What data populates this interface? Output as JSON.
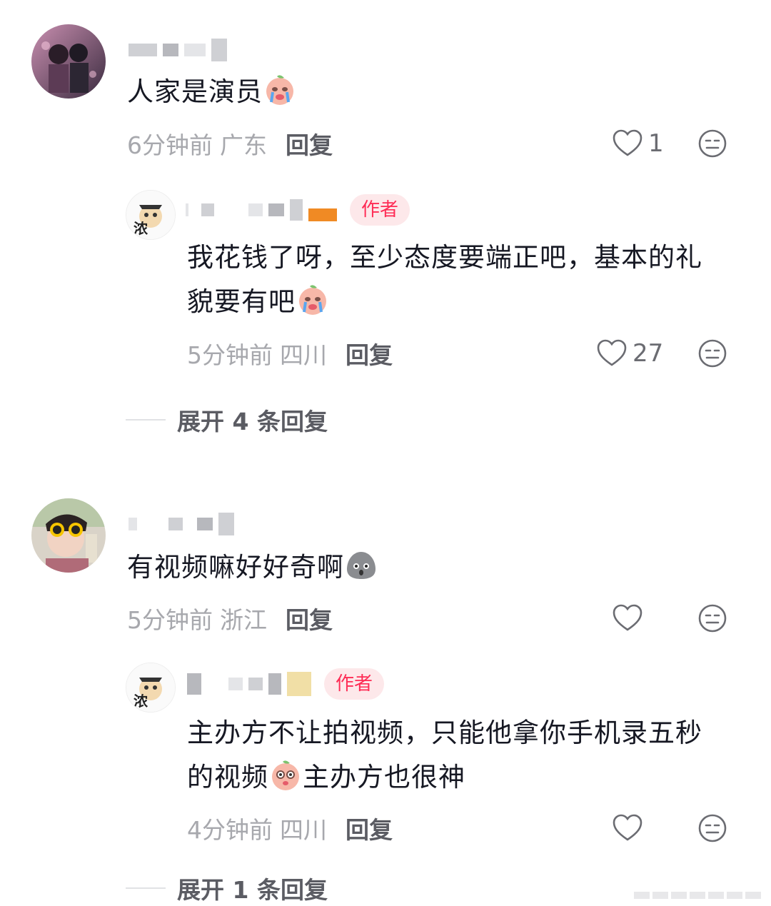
{
  "comments": [
    {
      "text": "人家是演员",
      "time": "6分钟前",
      "location": "广东",
      "reply_label": "回复",
      "likes": "1",
      "emoji": "crying-peach-emoji"
    },
    {
      "author_badge": "作者",
      "text_line1": "我花钱了呀，至少态度要端正吧，基本的礼",
      "text_line2": "貌要有吧",
      "time": "5分钟前",
      "location": "四川",
      "reply_label": "回复",
      "likes": "27",
      "emoji": "crying-peach-emoji",
      "expand_label": "展开 4 条回复"
    },
    {
      "text": "有视频嘛好好奇啊",
      "time": "5分钟前",
      "location": "浙江",
      "reply_label": "回复",
      "emoji": "surprised-gray-emoji"
    },
    {
      "author_badge": "作者",
      "text_line1": "主办方不让拍视频，只能他拿你手机录五秒",
      "text_line2a": "的视频",
      "text_line2b": "主办方也很神",
      "time": "4分钟前",
      "location": "四川",
      "reply_label": "回复",
      "emoji": "shocked-peach-emoji",
      "expand_label": "展开 1 条回复"
    }
  ],
  "colors": {
    "accent": "#fe2c55",
    "text": "#161823",
    "meta": "#a7a8ad"
  },
  "icons": [
    "heart-outline-icon",
    "dislike-face-icon"
  ]
}
